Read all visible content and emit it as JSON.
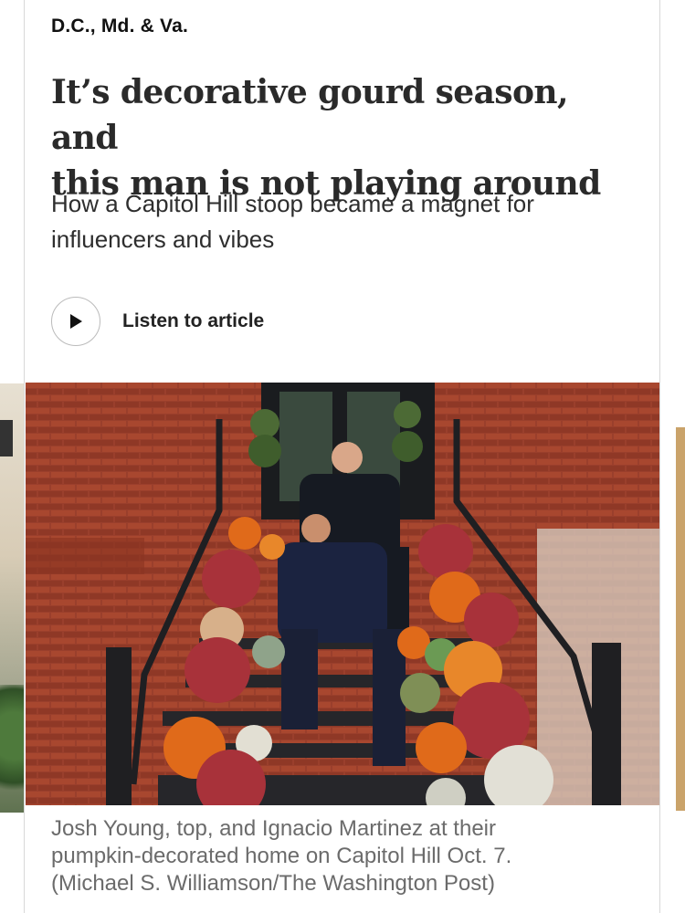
{
  "section": {
    "kicker": "D.C., Md. & Va."
  },
  "article": {
    "headline_line1": "It’s decorative gourd season, and",
    "headline_line2": "this man is not playing around",
    "dek_line1": "How a Capitol Hill stoop became a magnet for",
    "dek_line2": "influencers and vibes",
    "listen_label": "Listen to article"
  },
  "photo": {
    "caption_line1": "Josh Young, top, and Ignacio Martinez at their",
    "caption_line2": "pumpkin-decorated home on Capitol Hill Oct. 7.",
    "caption_line3": "(Michael S. Williamson/The Washington Post)"
  },
  "icons": {
    "play": "play-icon"
  },
  "colors": {
    "brick": "#9a3f2c",
    "pumpkin": "#e06a1a",
    "mums": "#a8323a",
    "railing": "#1f1f22"
  }
}
